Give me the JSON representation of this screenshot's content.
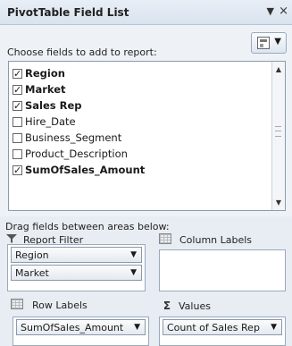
{
  "window": {
    "title": "PivotTable Field List",
    "dropdown_icon": "▼",
    "close_icon": "×"
  },
  "fields_section": {
    "prompt": "Choose fields to add to report:",
    "layout_button_arrow": "▼",
    "fields": [
      {
        "label": "Region",
        "checked": true
      },
      {
        "label": "Market",
        "checked": true
      },
      {
        "label": "Sales Rep",
        "checked": true
      },
      {
        "label": "Hire_Date",
        "checked": false
      },
      {
        "label": "Business_Segment",
        "checked": false
      },
      {
        "label": "Product_Description",
        "checked": false
      },
      {
        "label": "SumOfSales_Amount",
        "checked": true
      }
    ]
  },
  "areas_section": {
    "prompt": "Drag fields between areas below:",
    "report_filter": {
      "label": "Report Filter",
      "icon": "filter-icon",
      "items": [
        "Region",
        "Market"
      ]
    },
    "column_labels": {
      "label": "Column Labels",
      "icon": "grid-icon",
      "items": []
    },
    "row_labels": {
      "label": "Row Labels",
      "icon": "grid-icon",
      "items": [
        "SumOfSales_Amount"
      ]
    },
    "values": {
      "label": "Values",
      "icon": "sigma-icon",
      "items": [
        "Count of Sales Rep"
      ]
    }
  },
  "colors": {
    "panel_bg": "#edf1f6",
    "border": "#9aa9bc"
  }
}
